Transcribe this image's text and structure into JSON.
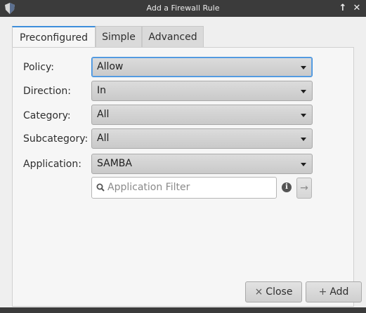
{
  "window": {
    "title": "Add a Firewall Rule"
  },
  "tabs": [
    {
      "label": "Preconfigured",
      "active": true
    },
    {
      "label": "Simple",
      "active": false
    },
    {
      "label": "Advanced",
      "active": false
    }
  ],
  "form": {
    "policy": {
      "label": "Policy:",
      "value": "Allow"
    },
    "direction": {
      "label": "Direction:",
      "value": "In"
    },
    "category": {
      "label": "Category:",
      "value": "All"
    },
    "subcategory": {
      "label": "Subcategory:",
      "value": "All"
    },
    "application": {
      "label": "Application:",
      "value": "SAMBA"
    },
    "filter": {
      "placeholder": "Application Filter",
      "value": ""
    }
  },
  "buttons": {
    "close": "Close",
    "add": "Add"
  },
  "icons": {
    "app": "shield-icon",
    "info": "info-icon",
    "arrow": "arrow-right-icon",
    "search": "search-icon"
  },
  "colors": {
    "accent": "#3d8edb",
    "titlebar": "#3b3b3b",
    "background": "#efefef"
  }
}
